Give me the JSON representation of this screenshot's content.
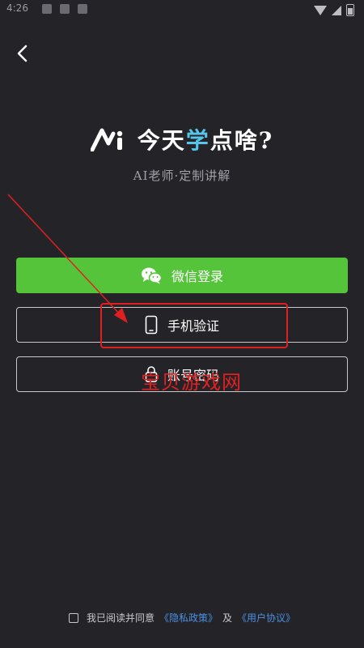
{
  "status_bar": {
    "time": "4:26"
  },
  "header": {
    "title_prefix": "今天",
    "title_highlight": "学",
    "title_suffix": "点啥?",
    "tagline": "AI老师·定制讲解"
  },
  "buttons": {
    "wechat": "微信登录",
    "phone": "手机验证",
    "account": "账号密码"
  },
  "overlay": {
    "watermark": "宝贝游戏网"
  },
  "agreement": {
    "prefix": "我已阅读并同意",
    "privacy": "《隐私政策》",
    "and": "及",
    "terms": "《用户协议》"
  },
  "colors": {
    "background": "#242428",
    "wechat_green": "#56c43b",
    "accent_blue": "#56c5ea",
    "link_blue": "#4a90e2",
    "annotation_red": "#e02020"
  },
  "icons": {
    "back": "chevron-left-icon",
    "wechat": "wechat-icon",
    "phone": "phone-icon",
    "account": "lock-icon"
  }
}
